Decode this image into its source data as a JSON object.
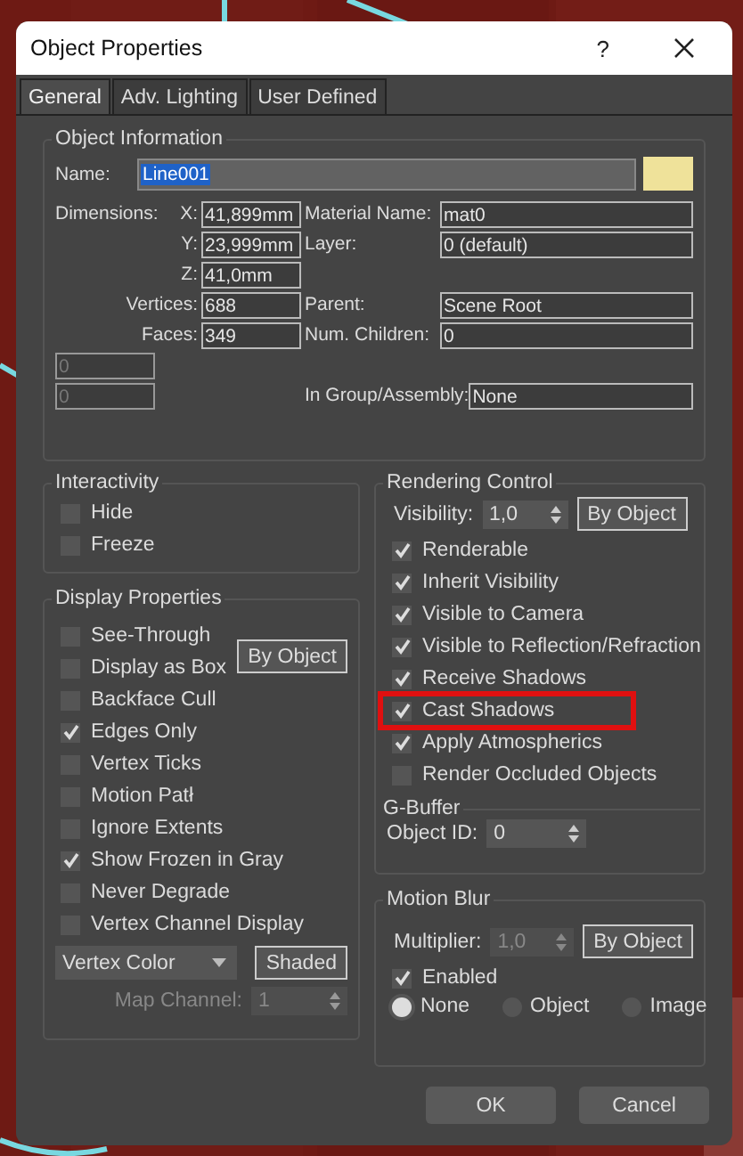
{
  "window": {
    "title": "Object Properties",
    "help": "?"
  },
  "tabs": [
    {
      "label": "General",
      "selected": true
    },
    {
      "label": "Adv. Lighting",
      "selected": false
    },
    {
      "label": "User Defined",
      "selected": false
    }
  ],
  "object_information": {
    "title": "Object Information",
    "name_label": "Name:",
    "name_value": "Line001",
    "dimensions_label": "Dimensions:",
    "rows": [
      {
        "left_label": "X:",
        "left_value": "41,899mm",
        "left_disabled": false,
        "right_label": "Material Name:",
        "right_value": "mat0"
      },
      {
        "left_label": "Y:",
        "left_value": "23,999mm",
        "left_disabled": false,
        "right_label": "Layer:",
        "right_value": "0 (default)"
      },
      {
        "left_label": "Z:",
        "left_value": "41,0mm",
        "left_disabled": false
      },
      {
        "left_label": "Vertices:",
        "left_value": "688",
        "left_disabled": false,
        "right_label": "Parent:",
        "right_value": "Scene Root"
      },
      {
        "left_label": "Faces:",
        "left_value": "349",
        "left_disabled": false,
        "right_label": "Num. Children:",
        "right_value": "0"
      },
      {
        "left_value": "0",
        "left_disabled": true
      },
      {
        "left_value": "0",
        "left_disabled": true,
        "right_label": "In Group/Assembly:",
        "right_value": "None"
      }
    ]
  },
  "interactivity": {
    "title": "Interactivity",
    "checkboxes": [
      {
        "label": "Hide",
        "checked": false
      },
      {
        "label": "Freeze",
        "checked": false
      }
    ]
  },
  "display_properties": {
    "title": "Display Properties",
    "button": "By Object",
    "checkboxes": [
      {
        "label": "See-Through",
        "checked": false
      },
      {
        "label": "Display as Box",
        "checked": false
      },
      {
        "label": "Backface Cull",
        "checked": false
      },
      {
        "label": "Edges Only",
        "checked": true
      },
      {
        "label": "Vertex Ticks",
        "checked": false
      },
      {
        "label": "Motion Patł",
        "checked": false
      },
      {
        "label": "Ignore Extents",
        "checked": false
      },
      {
        "label": "Show Frozen in Gray",
        "checked": true
      },
      {
        "label": "Never Degrade",
        "checked": false
      },
      {
        "label": "Vertex Channel Display",
        "checked": false
      }
    ],
    "dropdown": "Vertex Color",
    "shaded_button": "Shaded",
    "map_channel_label": "Map Channel:",
    "map_channel": {
      "value": "1",
      "disabled": true
    }
  },
  "rendering_control": {
    "title": "Rendering Control",
    "visibility_label": "Visibility:",
    "visibility": {
      "value": "1,0",
      "disabled": false
    },
    "button": "By Object",
    "checkboxes": [
      {
        "label": "Renderable",
        "checked": true,
        "highlighted": false
      },
      {
        "label": "Inherit Visibility",
        "checked": true,
        "highlighted": false
      },
      {
        "label": "Visible to Camera",
        "checked": true,
        "highlighted": false
      },
      {
        "label": "Visible to Reflection/Refraction",
        "checked": true,
        "highlighted": false
      },
      {
        "label": "Receive Shadows",
        "checked": true,
        "highlighted": false
      },
      {
        "label": "Cast Shadows",
        "checked": true,
        "highlighted": true
      },
      {
        "label": "Apply Atmospherics",
        "checked": true,
        "highlighted": false
      },
      {
        "label": "Render Occluded Objects",
        "checked": false,
        "highlighted": false
      }
    ],
    "g_buffer": {
      "title": "G-Buffer",
      "object_id_label": "Object ID:",
      "object_id": {
        "value": "0",
        "disabled": false
      }
    }
  },
  "motion_blur": {
    "title": "Motion Blur",
    "multiplier_label": "Multiplier:",
    "multiplier": {
      "value": "1,0",
      "disabled": true
    },
    "button": "By Object",
    "enabled": {
      "label": "Enabled",
      "checked": true
    },
    "radios": [
      {
        "label": "None",
        "selected": true
      },
      {
        "label": "Object",
        "selected": false
      },
      {
        "label": "Image",
        "selected": false
      }
    ]
  },
  "buttons": [
    "OK",
    "Cancel"
  ]
}
